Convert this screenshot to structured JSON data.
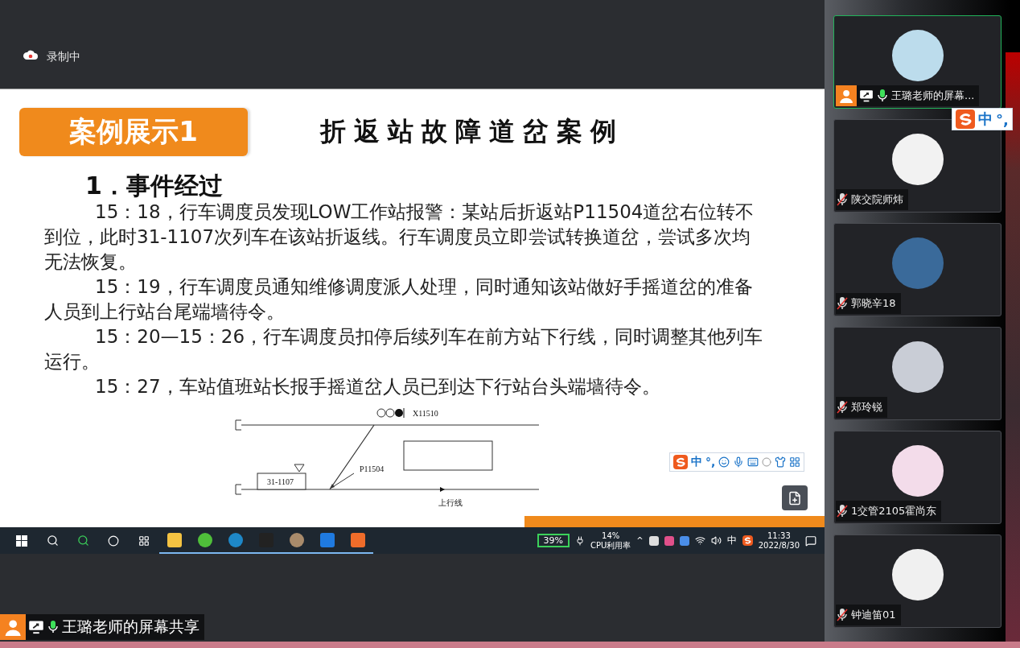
{
  "recording": {
    "label": "录制中"
  },
  "slide": {
    "badge": "案例展示1",
    "title": "折返站故障道岔案例",
    "heading": "1．事件经过",
    "paragraphs": [
      "15：18，行车调度员发现LOW工作站报警：某站后折返站P11504道岔右位转不到位，此时31-1107次列车在该站折返线。行车调度员立即尝试转换道岔，尝试多次均无法恢复。",
      "15：19，行车调度员通知维修调度派人处理，同时通知该站做好手摇道岔的准备人员到上行站台尾端墙待令。",
      "15：20—15：26，行车调度员扣停后续列车在前方站下行线，同时调整其他列车运行。",
      "15：27，车站值班站长报手摇道岔人员已到达下行站台头端墙待令。"
    ],
    "diagram": {
      "signal": "X11510",
      "switch": "P11504",
      "train": "31-1107",
      "track": "上行线"
    }
  },
  "slide_ime": {
    "mode": "中",
    "punct": "°,"
  },
  "taskbar": {
    "battery": "39%",
    "cpu_percent": "14%",
    "cpu_label": "CPU利用率",
    "tray_caret": "^",
    "ime": "中",
    "time": "11:33",
    "date": "2022/8/30"
  },
  "participants": [
    {
      "name": "王璐老师的屏幕...",
      "muted": false,
      "selected": true,
      "sharing": true
    },
    {
      "name": "陕交院师炜",
      "muted": true,
      "selected": false,
      "sharing": false
    },
    {
      "name": "郭晓辛18",
      "muted": true,
      "selected": false,
      "sharing": false
    },
    {
      "name": "郑玲锐",
      "muted": true,
      "selected": false,
      "sharing": false
    },
    {
      "name": "1交管2105霍尚东",
      "muted": true,
      "selected": false,
      "sharing": false
    },
    {
      "name": "钟迪笛01",
      "muted": true,
      "selected": false,
      "sharing": false
    }
  ],
  "floating_ime": {
    "mode": "中",
    "punct": "°,"
  },
  "share_label": {
    "text": "王璐老师的屏幕共享"
  }
}
